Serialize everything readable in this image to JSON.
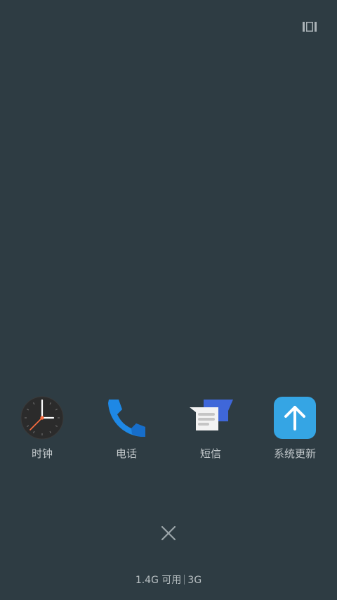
{
  "top_right": {
    "icon": "layout-toggle-icon"
  },
  "apps": [
    {
      "label": "时钟",
      "icon": "clock-icon"
    },
    {
      "label": "电话",
      "icon": "phone-icon"
    },
    {
      "label": "短信",
      "icon": "messages-icon"
    },
    {
      "label": "系统更新",
      "icon": "system-update-icon"
    }
  ],
  "close": {
    "icon": "close-icon"
  },
  "memory": {
    "available": "1.4G 可用",
    "total": "3G"
  },
  "colors": {
    "background": "#2e3c43",
    "phone_blue": "#1e88e5",
    "update_blue": "#35a5e4",
    "message_blue": "#3f67d9",
    "clock_hand": "#ff6e40"
  }
}
